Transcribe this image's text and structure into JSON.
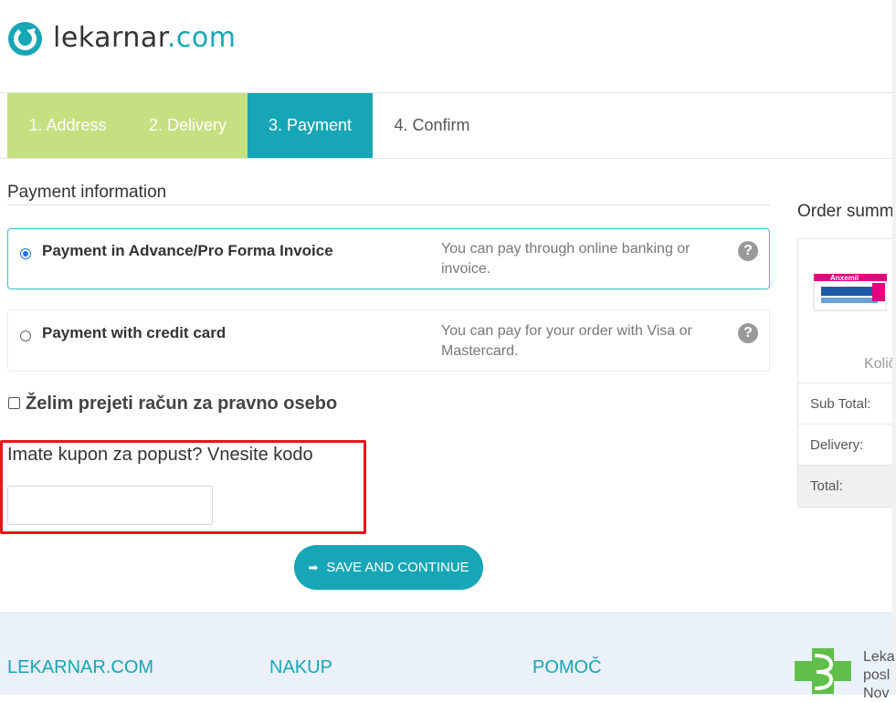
{
  "header": {
    "logo_name": "lekarnar",
    "logo_tld": ".com"
  },
  "steps": [
    {
      "label": "1. Address",
      "state": "done"
    },
    {
      "label": "2. Delivery",
      "state": "done"
    },
    {
      "label": "3. Payment",
      "state": "active"
    },
    {
      "label": "4. Confirm",
      "state": "pending"
    }
  ],
  "payment": {
    "title": "Payment information",
    "options": [
      {
        "label": "Payment in Advance/Pro Forma Invoice",
        "desc": "You can pay through online banking or invoice.",
        "selected": true
      },
      {
        "label": "Payment with credit card",
        "desc": "You can pay for your order with Visa or Mastercard.",
        "selected": false
      }
    ],
    "help_glyph": "?"
  },
  "legal_entity": {
    "label": "Želim prejeti račun za pravno osebo",
    "checked": false
  },
  "coupon": {
    "label": "Imate kupon za popust? Vnesite kodo",
    "value": "",
    "placeholder": ""
  },
  "save_button": {
    "label": "SAVE AND CONTINUE",
    "icon": "arrow-right-icon"
  },
  "summary": {
    "title": "Order summ",
    "product_name": "Anxemil",
    "qty_label": "Količ",
    "rows": [
      {
        "label": "Sub Total:"
      },
      {
        "label": "Delivery:"
      },
      {
        "label": "Total:"
      }
    ]
  },
  "footer": {
    "columns": [
      "LEKARNAR.COM",
      "NAKUP",
      "POMOČ"
    ],
    "side_text": [
      "Leka",
      "posl",
      "Nov"
    ]
  },
  "colors": {
    "accent": "#17a6b5",
    "step_done": "#c6df80",
    "highlight": "#e8151b",
    "footer_bg": "#eaf1fa"
  }
}
